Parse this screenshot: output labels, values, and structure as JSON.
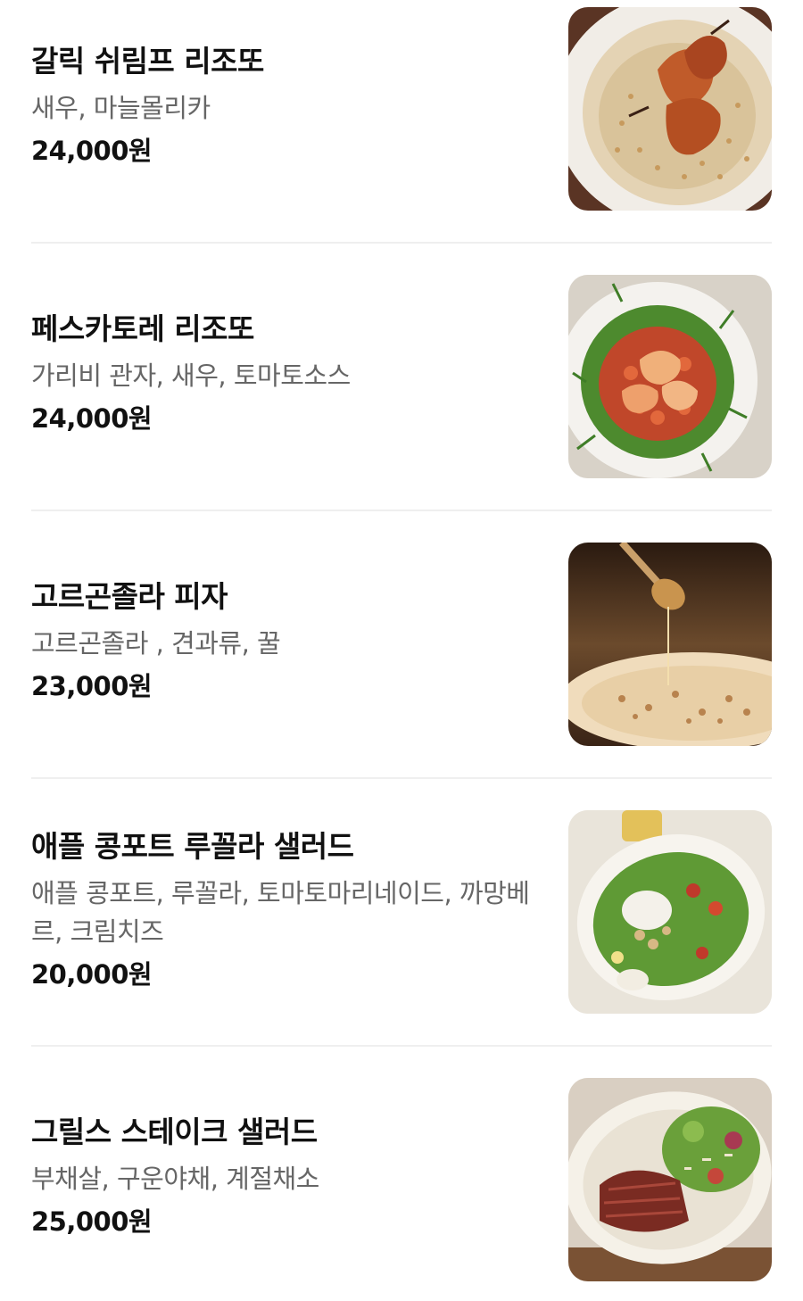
{
  "menu": {
    "items": [
      {
        "name": "갈릭 쉬림프 리조또",
        "description": "새우, 마늘몰리카",
        "price": "24,000원",
        "image_icon": "garlic-shrimp-risotto-photo"
      },
      {
        "name": "페스카토레 리조또",
        "description": "가리비 관자, 새우, 토마토소스",
        "price": "24,000원",
        "image_icon": "pescatore-risotto-photo"
      },
      {
        "name": "고르곤졸라 피자",
        "description": "고르곤졸라 , 견과류, 꿀",
        "price": "23,000원",
        "image_icon": "gorgonzola-pizza-photo"
      },
      {
        "name": "애플 콩포트 루꼴라 샐러드",
        "description": "애플 콩포트, 루꼴라, 토마토마리네이드, 까망베르, 크림치즈",
        "price": "20,000원",
        "image_icon": "apple-compote-arugula-salad-photo"
      },
      {
        "name": "그릴스 스테이크 샐러드",
        "description": "부채살, 구운야채, 계절채소",
        "price": "25,000원",
        "image_icon": "grilled-steak-salad-photo"
      }
    ]
  },
  "colors": {
    "title": "#111111",
    "description": "#666666",
    "price": "#111111",
    "divider": "#efefef",
    "background": "#ffffff"
  }
}
